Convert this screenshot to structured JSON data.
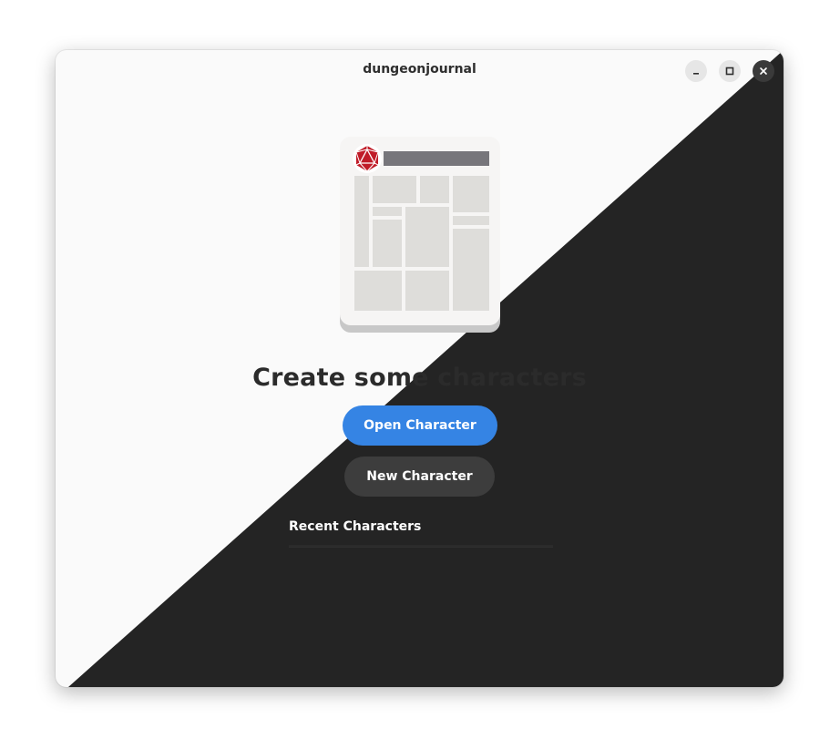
{
  "window": {
    "title": "dungeonjournal"
  },
  "titlebar": {
    "buttons": [
      {
        "name": "minimize",
        "icon": "minimize-icon"
      },
      {
        "name": "maximize",
        "icon": "maximize-icon"
      },
      {
        "name": "close",
        "icon": "close-icon"
      }
    ]
  },
  "main": {
    "illustration_icon": "character-sheet-illustration",
    "heading": "Create some characters",
    "open_button_label": "Open Character",
    "new_button_label": "New Character",
    "recent_label": "Recent Characters"
  },
  "colors": {
    "accent": "#3584e4",
    "dark_bg": "#242424",
    "light_bg": "#fafafa",
    "secondary_button": "#3d3d3d",
    "d20_red": "#c01c28"
  }
}
